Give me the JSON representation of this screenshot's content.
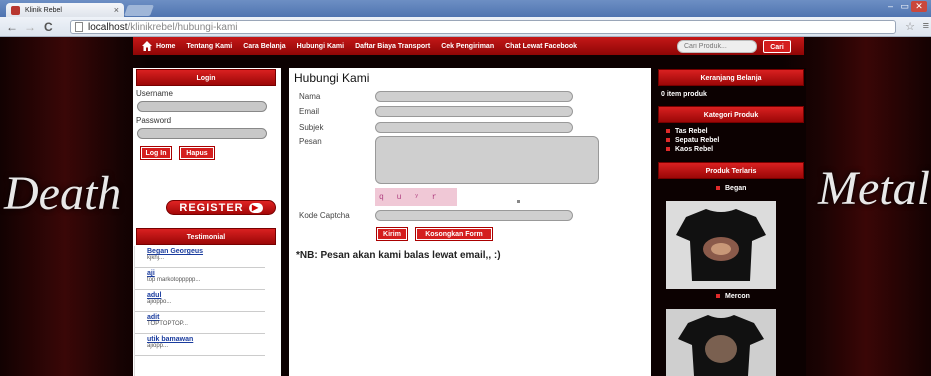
{
  "browser": {
    "tab_title": "Klinik Rebel",
    "tab_close": "×",
    "url_host": "localhost",
    "url_path": "/klinikrebel/hubungi-kami",
    "back_icon": "←",
    "forward_icon": "→",
    "reload_icon": "C",
    "star_icon": "☆",
    "wrench_icon": "≡",
    "min_icon": "–",
    "max_icon": "▭",
    "close_icon": "✕"
  },
  "background": {
    "left_text": "Death",
    "right_text": "Metal"
  },
  "nav": {
    "home": "Home",
    "items": [
      "Tentang Kami",
      "Cara Belanja",
      "Hubungi Kami",
      "Daftar Biaya Transport",
      "Cek Pengiriman",
      "Chat Lewat Facebook"
    ],
    "search_placeholder": "Cari Produk...",
    "search_button": "Cari"
  },
  "login": {
    "title": "Login",
    "username_label": "Username",
    "password_label": "Password",
    "login_button": "Log In",
    "reset_button": "Hapus",
    "register_button": "REGISTER"
  },
  "testimonial": {
    "title": "Testimonial",
    "items": [
      {
        "name": "Began Georgeus",
        "msg": "kjkhj..."
      },
      {
        "name": "aji",
        "msg": "top markotoppppp..."
      },
      {
        "name": "adul",
        "msg": "ajioppo..."
      },
      {
        "name": "adit",
        "msg": "TOPTOPTOP..."
      },
      {
        "name": "utik bamawan",
        "msg": "ajiopp..."
      }
    ]
  },
  "contact": {
    "title": "Hubungi Kami",
    "nama_label": "Nama",
    "email_label": "Email",
    "subjek_label": "Subjek",
    "pesan_label": "Pesan",
    "captcha_text": "q u ʸ r ⁶",
    "captcha_label": "Kode Captcha",
    "send_button": "Kirim",
    "clear_button": "Kosongkan Form",
    "note": "*NB: Pesan akan kami balas lewat email,, :)"
  },
  "cart": {
    "title": "Keranjang Belanja",
    "count_text": "0 item produk"
  },
  "categories": {
    "title": "Kategori Produk",
    "items": [
      "Tas Rebel",
      "Sepatu Rebel",
      "Kaos Rebel"
    ]
  },
  "bestseller": {
    "title": "Produk Terlaris",
    "products": [
      "Began",
      "Mercon"
    ]
  },
  "colors": {
    "accent_red": "#d41e1e",
    "link_blue": "#1a3c9e",
    "page_dark": "#0c0101"
  }
}
